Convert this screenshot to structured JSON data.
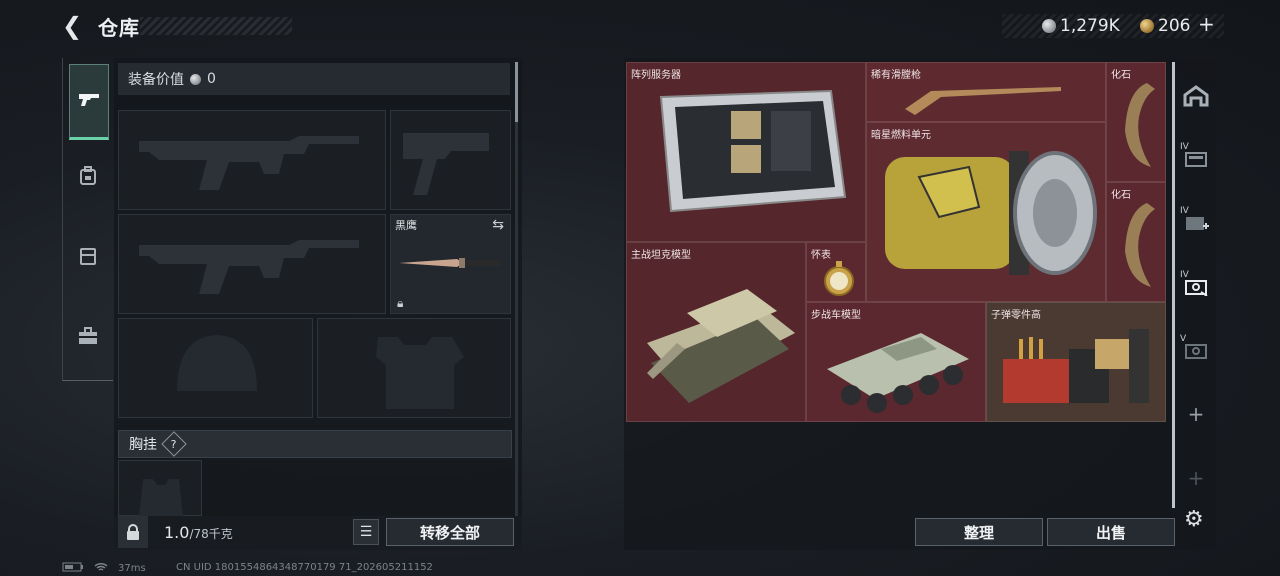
{
  "header": {
    "title": "仓库",
    "currency": [
      {
        "icon": "silver-coin-icon",
        "value": "1,279K"
      },
      {
        "icon": "gold-coin-icon",
        "value": "206"
      }
    ],
    "add_label": "+"
  },
  "left_tabs": [
    {
      "icon": "pistol-icon",
      "active": true
    },
    {
      "icon": "backpack-icon",
      "active": false
    },
    {
      "icon": "vest-icon",
      "active": false
    },
    {
      "icon": "toolbox-icon",
      "active": false
    }
  ],
  "equipment": {
    "value_label": "装备价值",
    "value": "0",
    "knife_name": "黑鹰",
    "chest_label": "胸挂",
    "help": "?"
  },
  "footer_left": {
    "weight": "1.0",
    "weight_max": "/78千克",
    "transfer_all": "转移全部"
  },
  "stash_items": {
    "server": "阵列服务器",
    "musket": "稀有滑膛枪",
    "fossil_a": "化石",
    "fuel": "暗星燃料单元",
    "fossil_b": "化石",
    "tank": "主战坦克模型",
    "watch": "怀表",
    "ifv": "步战车模型",
    "ammo": "子弹零件高"
  },
  "right_tabs": [
    {
      "icon": "stash-icon",
      "roman": ""
    },
    {
      "icon": "container-iv-icon",
      "roman": "IV"
    },
    {
      "icon": "container-iv-add-icon",
      "roman": "IV"
    },
    {
      "icon": "container-iv-active-icon",
      "roman": "IV"
    },
    {
      "icon": "container-v-icon",
      "roman": "V"
    },
    {
      "icon": "add-icon",
      "roman": ""
    },
    {
      "icon": "add-icon-dim",
      "roman": ""
    }
  ],
  "footer_right": {
    "sort": "整理",
    "sell": "出售"
  },
  "status": {
    "ping": "37ms",
    "uid": "CN UID 1801554864348770179 71_202605211152"
  }
}
